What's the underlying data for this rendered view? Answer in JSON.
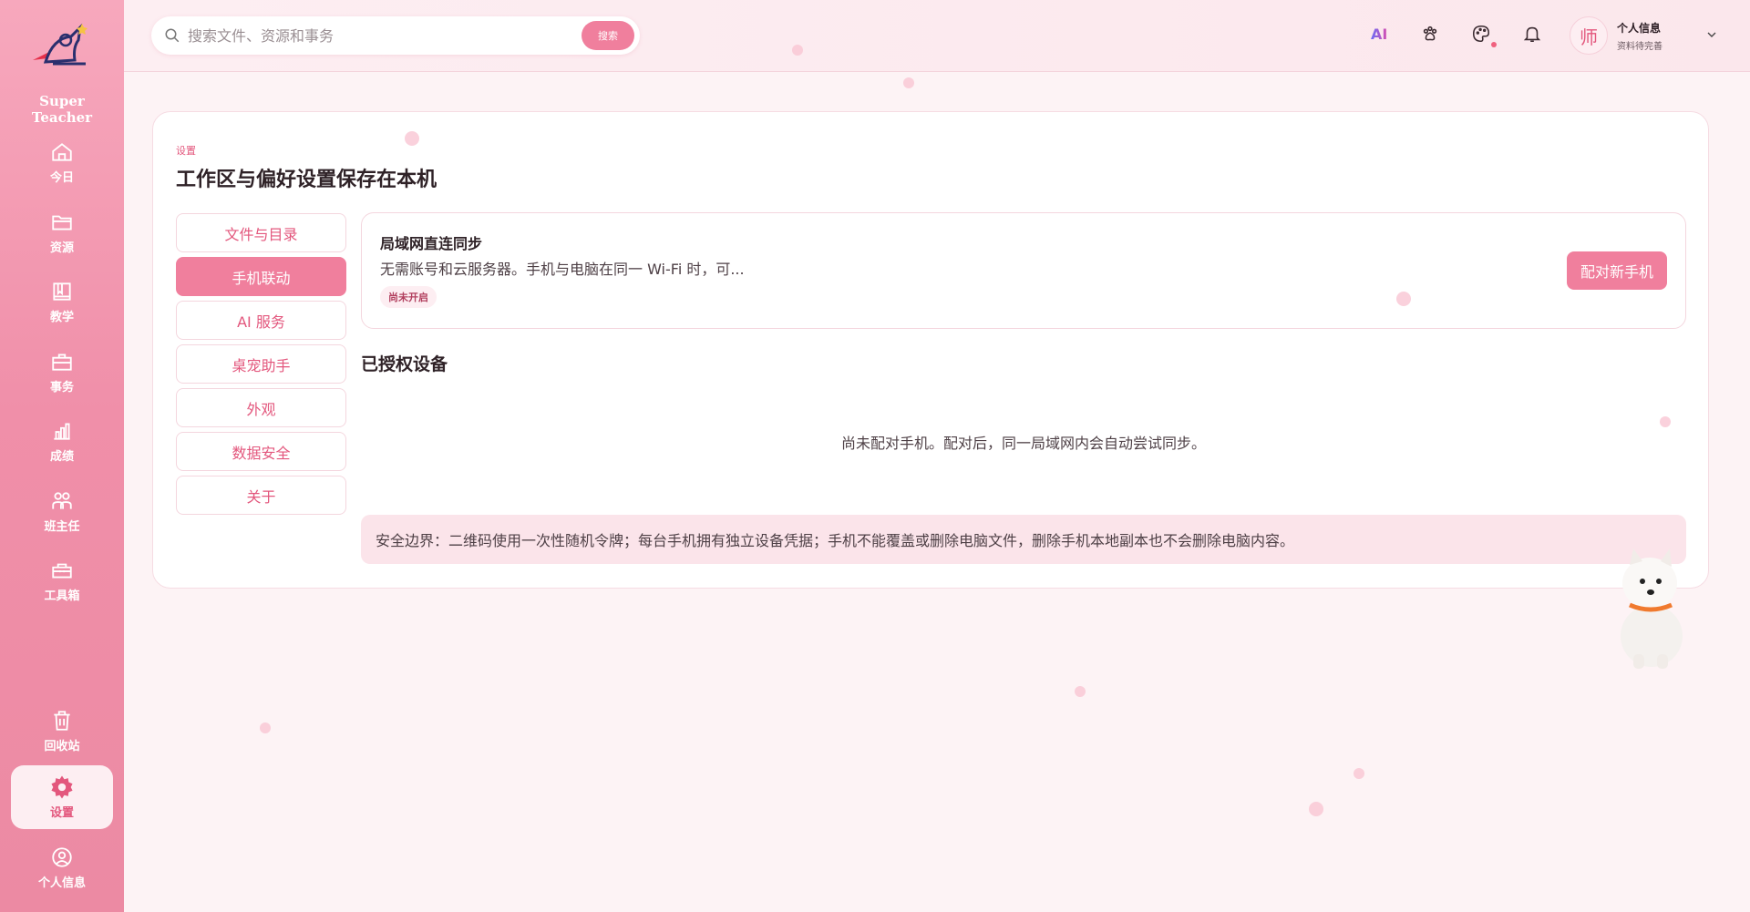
{
  "app": {
    "brand_line1": "Super",
    "brand_line2": "Teacher"
  },
  "sidebar": {
    "items": [
      {
        "label": "今日",
        "icon": "home-icon"
      },
      {
        "label": "资源",
        "icon": "folder-icon"
      },
      {
        "label": "教学",
        "icon": "book-icon"
      },
      {
        "label": "事务",
        "icon": "briefcase-icon"
      },
      {
        "label": "成绩",
        "icon": "bar-chart-icon"
      },
      {
        "label": "班主任",
        "icon": "group-icon"
      },
      {
        "label": "工具箱",
        "icon": "toolbox-icon"
      }
    ],
    "bottom_items": [
      {
        "label": "回收站",
        "icon": "trash-icon"
      },
      {
        "label": "设置",
        "icon": "gear-icon",
        "active": true
      },
      {
        "label": "个人信息",
        "icon": "user-icon"
      }
    ]
  },
  "topbar": {
    "search_placeholder": "搜索文件、资源和事务",
    "search_button": "搜索",
    "ai_label": "AI",
    "avatar_char": "师",
    "user_name": "个人信息",
    "user_sub": "资料待完善"
  },
  "settings": {
    "breadcrumb": "设置",
    "title": "工作区与偏好设置保存在本机",
    "menu": [
      {
        "label": "文件与目录",
        "active": false
      },
      {
        "label": "手机联动",
        "active": true
      },
      {
        "label": "AI 服务",
        "active": false
      },
      {
        "label": "桌宠助手",
        "active": false
      },
      {
        "label": "外观",
        "active": false
      },
      {
        "label": "数据安全",
        "active": false
      },
      {
        "label": "关于",
        "active": false
      }
    ],
    "sync": {
      "title": "局域网直连同步",
      "description": "无需账号和云服务器。手机与电脑在同一 Wi-Fi 时，可...",
      "status": "尚未开启",
      "pair_button": "配对新手机"
    },
    "devices_title": "已授权设备",
    "empty_text": "尚未配对手机。配对后，同一局域网内会自动尝试同步。",
    "notice": "安全边界：二维码使用一次性随机令牌；每台手机拥有独立设备凭据；手机不能覆盖或删除电脑文件，删除手机本地副本也不会删除电脑内容。"
  },
  "colors": {
    "accent": "#f07f9d",
    "sidebar": "#f08fa9",
    "text_accent": "#e3577d"
  }
}
